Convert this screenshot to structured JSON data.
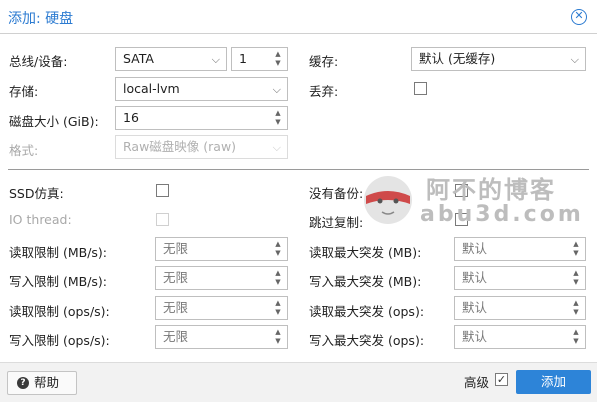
{
  "dialog": {
    "title": "添加: 硬盘"
  },
  "form": {
    "bus_label": "总线/设备:",
    "bus_value": "SATA",
    "device_value": "1",
    "storage_label": "存储:",
    "storage_value": "local-lvm",
    "size_label": "磁盘大小 (GiB):",
    "size_value": "16",
    "format_label": "格式:",
    "format_value": "Raw磁盘映像 (raw)",
    "cache_label": "缓存:",
    "cache_value": "默认 (无缓存)",
    "discard_label": "丢弃:",
    "ssd_label": "SSD仿真:",
    "iothread_label": "IO thread:",
    "nobackup_label": "没有备份:",
    "skipreplication_label": "跳过复制:"
  },
  "limits": {
    "read_mb_label": "读取限制 (MB/s):",
    "read_mb_placeholder": "无限",
    "write_mb_label": "写入限制 (MB/s):",
    "write_mb_placeholder": "无限",
    "read_ops_label": "读取限制 (ops/s):",
    "read_ops_placeholder": "无限",
    "write_ops_label": "写入限制 (ops/s):",
    "write_ops_placeholder": "无限",
    "read_burst_mb_label": "读取最大突发 (MB):",
    "read_burst_mb_placeholder": "默认",
    "write_burst_mb_label": "写入最大突发 (MB):",
    "write_burst_mb_placeholder": "默认",
    "read_burst_ops_label": "读取最大突发 (ops):",
    "read_burst_ops_placeholder": "默认",
    "write_burst_ops_label": "写入最大突发 (ops):",
    "write_burst_ops_placeholder": "默认"
  },
  "footer": {
    "help_label": "帮助",
    "advanced_label": "高级",
    "advanced_checked": true,
    "add_label": "添加"
  },
  "watermark": {
    "text": "阿不的博客",
    "sub": "abu3d.com"
  },
  "colors": {
    "accent": "#2c7bd1",
    "add_button": "#2d84d8"
  }
}
